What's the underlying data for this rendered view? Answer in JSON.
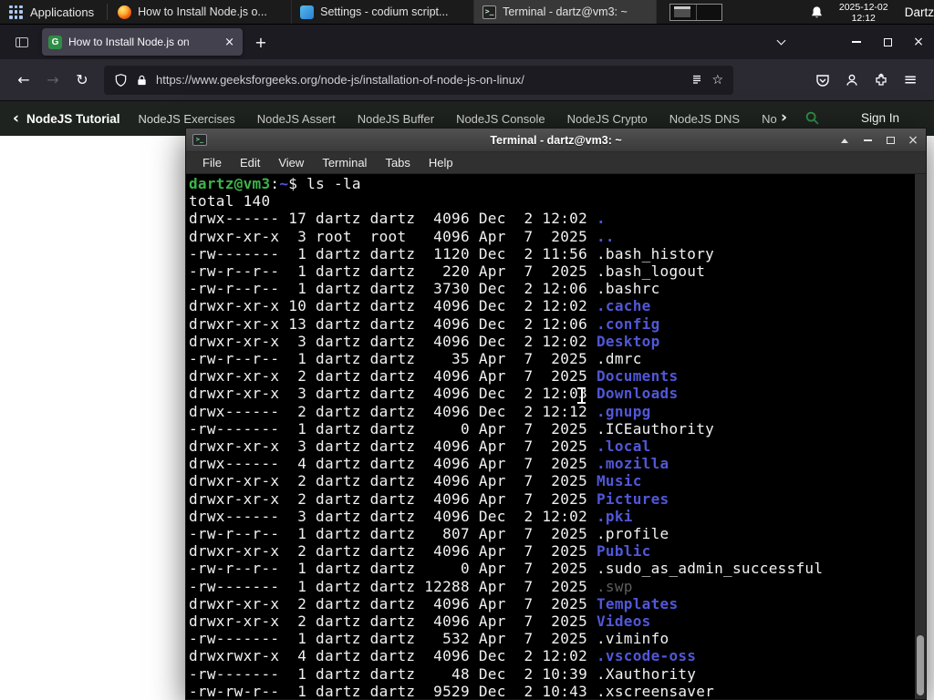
{
  "colors": {
    "terminal_green": "#3cb54a",
    "terminal_blue": "#5157d8",
    "terminal_dim": "#5e5e5e",
    "terminal_fg": "#f2f2f2",
    "gfg_green": "#2f8d46"
  },
  "glyphs": {
    "back": "←",
    "forward": "→",
    "reload": "↻",
    "new_tab": "+",
    "tab_close": "×",
    "window_close": "×",
    "menu": "≡",
    "star": "☆",
    "nav_back": "‹",
    "nav_next": "›",
    "terminal_glyph": ">_",
    "title_close": "×"
  },
  "panel": {
    "applications_label": "Applications",
    "tasks": [
      {
        "icon": "firefox",
        "title": "How to Install Node.js o...",
        "active": false
      },
      {
        "icon": "codium",
        "title": "Settings - codium script...",
        "active": false
      },
      {
        "icon": "terminal",
        "title": "Terminal - dartz@vm3: ~",
        "active": true
      }
    ],
    "clock_date": "2025-12-02",
    "clock_time": "12:12",
    "user_label": "Dartz"
  },
  "browser": {
    "tab_title": "How to Install Node.js on",
    "url": "https://www.geeksforgeeks.org/node-js/installation-of-node-js-on-linux/"
  },
  "gfg_nav": {
    "primary_label": "NodeJS Tutorial",
    "links": [
      "NodeJS Exercises",
      "NodeJS Assert",
      "NodeJS Buffer",
      "NodeJS Console",
      "NodeJS Crypto",
      "NodeJS DNS",
      "Node"
    ],
    "sign_in_label": "Sign In"
  },
  "terminal_window": {
    "title": "Terminal - dartz@vm3: ~",
    "menus": [
      "File",
      "Edit",
      "View",
      "Terminal",
      "Tabs",
      "Help"
    ],
    "lines": [
      [
        {
          "t": "dartz@vm3",
          "c": "green"
        },
        {
          "t": ":",
          "c": "fg"
        },
        {
          "t": "~",
          "c": "blue"
        },
        {
          "t": "$ ",
          "c": "fg"
        },
        {
          "t": "ls -la",
          "c": "fg"
        }
      ],
      [
        {
          "t": "total 140",
          "c": "fg"
        }
      ],
      [
        {
          "t": "drwx------ 17 dartz dartz  4096 Dec  2 12:02 ",
          "c": "fg"
        },
        {
          "t": ".",
          "c": "dir"
        }
      ],
      [
        {
          "t": "drwxr-xr-x  3 root  root   4096 Apr  7  2025 ",
          "c": "fg"
        },
        {
          "t": "..",
          "c": "dir"
        }
      ],
      [
        {
          "t": "-rw-------  1 dartz dartz  1120 Dec  2 11:56 .bash_history",
          "c": "fg"
        }
      ],
      [
        {
          "t": "-rw-r--r--  1 dartz dartz   220 Apr  7  2025 .bash_logout",
          "c": "fg"
        }
      ],
      [
        {
          "t": "-rw-r--r--  1 dartz dartz  3730 Dec  2 12:06 .bashrc",
          "c": "fg"
        }
      ],
      [
        {
          "t": "drwxr-xr-x 10 dartz dartz  4096 Dec  2 12:02 ",
          "c": "fg"
        },
        {
          "t": ".cache",
          "c": "dir"
        }
      ],
      [
        {
          "t": "drwxr-xr-x 13 dartz dartz  4096 Dec  2 12:06 ",
          "c": "fg"
        },
        {
          "t": ".config",
          "c": "dir"
        }
      ],
      [
        {
          "t": "drwxr-xr-x  3 dartz dartz  4096 Dec  2 12:02 ",
          "c": "fg"
        },
        {
          "t": "Desktop",
          "c": "dir"
        }
      ],
      [
        {
          "t": "-rw-r--r--  1 dartz dartz    35 Apr  7  2025 .dmrc",
          "c": "fg"
        }
      ],
      [
        {
          "t": "drwxr-xr-x  2 dartz dartz  4096 Apr  7  2025 ",
          "c": "fg"
        },
        {
          "t": "Documents",
          "c": "dir"
        }
      ],
      [
        {
          "t": "drwxr-xr-x  3 dartz dartz  4096 Dec  2 12:03 ",
          "c": "fg"
        },
        {
          "t": "Downloads",
          "c": "dir"
        }
      ],
      [
        {
          "t": "drwx------  2 dartz dartz  4096 Dec  2 12:12 ",
          "c": "fg"
        },
        {
          "t": ".gnupg",
          "c": "dir"
        }
      ],
      [
        {
          "t": "-rw-------  1 dartz dartz     0 Apr  7  2025 .ICEauthority",
          "c": "fg"
        }
      ],
      [
        {
          "t": "drwxr-xr-x  3 dartz dartz  4096 Apr  7  2025 ",
          "c": "fg"
        },
        {
          "t": ".local",
          "c": "dir"
        }
      ],
      [
        {
          "t": "drwx------  4 dartz dartz  4096 Apr  7  2025 ",
          "c": "fg"
        },
        {
          "t": ".mozilla",
          "c": "dir"
        }
      ],
      [
        {
          "t": "drwxr-xr-x  2 dartz dartz  4096 Apr  7  2025 ",
          "c": "fg"
        },
        {
          "t": "Music",
          "c": "dir"
        }
      ],
      [
        {
          "t": "drwxr-xr-x  2 dartz dartz  4096 Apr  7  2025 ",
          "c": "fg"
        },
        {
          "t": "Pictures",
          "c": "dir"
        }
      ],
      [
        {
          "t": "drwx------  3 dartz dartz  4096 Dec  2 12:02 ",
          "c": "fg"
        },
        {
          "t": ".pki",
          "c": "dir"
        }
      ],
      [
        {
          "t": "-rw-r--r--  1 dartz dartz   807 Apr  7  2025 .profile",
          "c": "fg"
        }
      ],
      [
        {
          "t": "drwxr-xr-x  2 dartz dartz  4096 Apr  7  2025 ",
          "c": "fg"
        },
        {
          "t": "Public",
          "c": "dir"
        }
      ],
      [
        {
          "t": "-rw-r--r--  1 dartz dartz     0 Apr  7  2025 .sudo_as_admin_successful",
          "c": "fg"
        }
      ],
      [
        {
          "t": "-rw-------  1 dartz dartz 12288 Apr  7  2025 ",
          "c": "fg"
        },
        {
          "t": ".swp",
          "c": "dim"
        }
      ],
      [
        {
          "t": "drwxr-xr-x  2 dartz dartz  4096 Apr  7  2025 ",
          "c": "fg"
        },
        {
          "t": "Templates",
          "c": "dir"
        }
      ],
      [
        {
          "t": "drwxr-xr-x  2 dartz dartz  4096 Apr  7  2025 ",
          "c": "fg"
        },
        {
          "t": "Videos",
          "c": "dir"
        }
      ],
      [
        {
          "t": "-rw-------  1 dartz dartz   532 Apr  7  2025 .viminfo",
          "c": "fg"
        }
      ],
      [
        {
          "t": "drwxrwxr-x  4 dartz dartz  4096 Dec  2 12:02 ",
          "c": "fg"
        },
        {
          "t": ".vscode-oss",
          "c": "dir"
        }
      ],
      [
        {
          "t": "-rw-------  1 dartz dartz    48 Dec  2 10:39 .Xauthority",
          "c": "fg"
        }
      ],
      [
        {
          "t": "-rw-rw-r--  1 dartz dartz  9529 Dec  2 10:43 .xscreensaver",
          "c": "fg"
        }
      ]
    ]
  }
}
